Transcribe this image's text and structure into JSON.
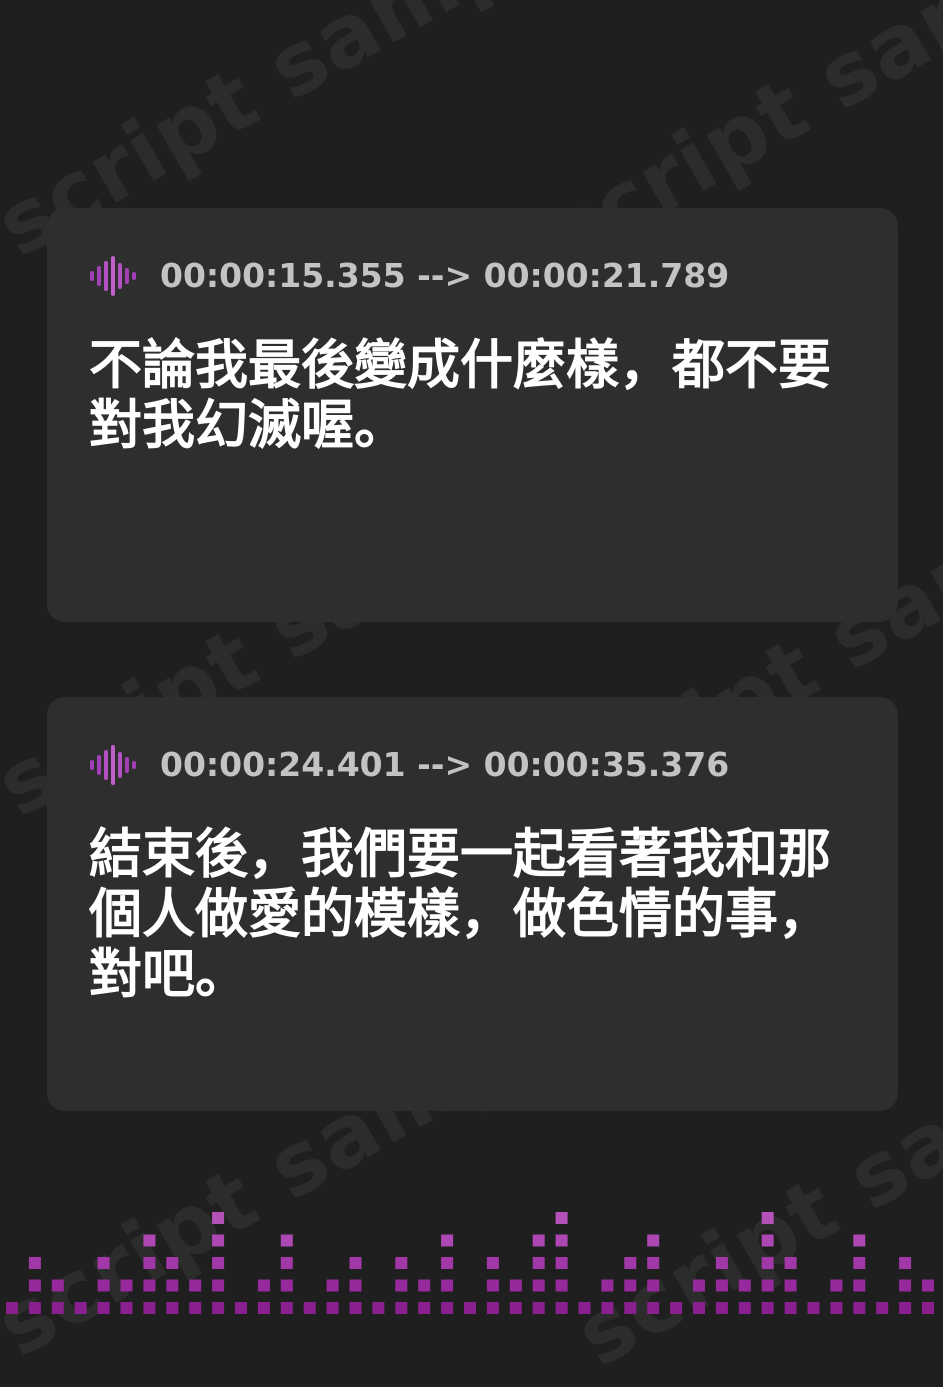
{
  "watermark": "script sample",
  "colors": {
    "background": "#1f1f1f",
    "card": "#2e2e2e",
    "timestamp_text": "#c3c3c3",
    "subtitle_text": "#ffffff",
    "accent": "#a13fb8",
    "accent_light": "#c061c9"
  },
  "cards": [
    {
      "icon": "audio-wave-icon",
      "timestamp": "00:00:15.355 --> 00:00:21.789",
      "text": "不論我最後變成什麼樣，都不要對我幻滅喔。"
    },
    {
      "icon": "audio-wave-icon",
      "timestamp": "00:00:24.401 --> 00:00:35.376",
      "text": "結束後，我們要一起看著我和那個人做愛的模樣，做色情的事，對吧。"
    }
  ],
  "equalizer": {
    "levels": [
      1,
      3,
      2,
      1,
      3,
      2,
      4,
      3,
      2,
      5,
      1,
      2,
      4,
      1,
      2,
      3,
      1,
      3,
      2,
      4,
      1,
      3,
      2,
      4,
      5,
      1,
      2,
      3,
      4,
      1,
      2,
      3,
      2,
      5,
      3,
      1,
      2,
      4,
      1,
      3,
      2,
      1
    ]
  }
}
